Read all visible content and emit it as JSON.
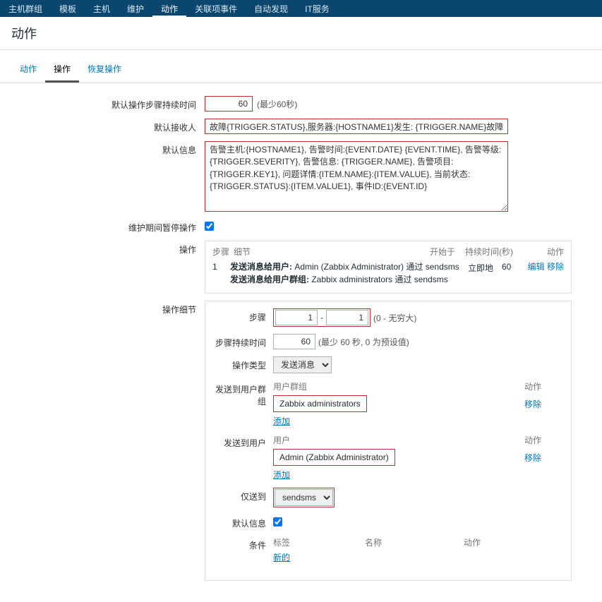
{
  "topnav": {
    "items": [
      "主机群组",
      "模板",
      "主机",
      "维护",
      "动作",
      "关联项事件",
      "自动发现",
      "IT服务"
    ],
    "active_index": 4
  },
  "page": {
    "title": "动作"
  },
  "tabs": {
    "items": [
      "动作",
      "操作",
      "恢复操作"
    ],
    "active_index": 1
  },
  "form": {
    "step_duration_label": "默认操作步骤持续时间",
    "step_duration_value": "60",
    "step_duration_hint": "(最少60秒)",
    "recipient_label": "默认接收人",
    "recipient_value": "故障{TRIGGER.STATUS},服务器:{HOSTNAME1}发生: {TRIGGER.NAME}故障",
    "default_msg_label": "默认信息",
    "default_msg_value": "告警主机:{HOSTNAME1}, 告警时间:{EVENT.DATE} {EVENT.TIME}, 告警等级:{TRIGGER.SEVERITY}, 告警信息: {TRIGGER.NAME}, 告警项目:{TRIGGER.KEY1}, 问题详情:{ITEM.NAME}:{ITEM.VALUE}, 当前状态:{TRIGGER.STATUS}:{ITEM.VALUE1}, 事件ID:{EVENT.ID}",
    "maintenance_label": "维护期间暂停操作",
    "maintenance_checked": true
  },
  "operations": {
    "label": "操作",
    "head": {
      "step": "步骤",
      "detail": "细节",
      "start": "开始于",
      "duration": "持续时间(秒)",
      "action": "动作"
    },
    "rows": [
      {
        "num": "1",
        "line1_prefix": "发送消息给用户:",
        "line1_rest": " Admin (Zabbix Administrator) 通过 sendsms",
        "line2_prefix": "发送消息给用户群组:",
        "line2_rest": " Zabbix administrators 通过 sendsms",
        "start": "立即地",
        "duration": "60",
        "edit": "编辑",
        "remove": "移除"
      }
    ]
  },
  "detail": {
    "label": "操作细节",
    "step_label": "步骤",
    "step_from": "1",
    "step_to": "1",
    "step_hint": "(0 - 无穷大)",
    "step_dash": "-",
    "step_duration_label": "步骤持续时间",
    "step_duration_value": "60",
    "step_duration_hint": "(最少 60 秒, 0 为预设值)",
    "op_type_label": "操作类型",
    "op_type_value": "发送消息",
    "send_group": {
      "label": "发送到用户群组",
      "head_name": "用户群组",
      "head_action": "动作",
      "value": "Zabbix administrators",
      "remove": "移除",
      "add": "添加"
    },
    "send_user": {
      "label": "发送到用户",
      "head_name": "用户",
      "head_action": "动作",
      "value": "Admin (Zabbix Administrator)",
      "remove": "移除",
      "add": "添加"
    },
    "send_via_label": "仅送到",
    "send_via_value": "sendsms",
    "default_msg_label": "默认信息",
    "default_msg_checked": true,
    "cond": {
      "label": "条件",
      "head_tag": "标签",
      "head_name": "名称",
      "head_action": "动作",
      "new_link": "新的"
    }
  }
}
